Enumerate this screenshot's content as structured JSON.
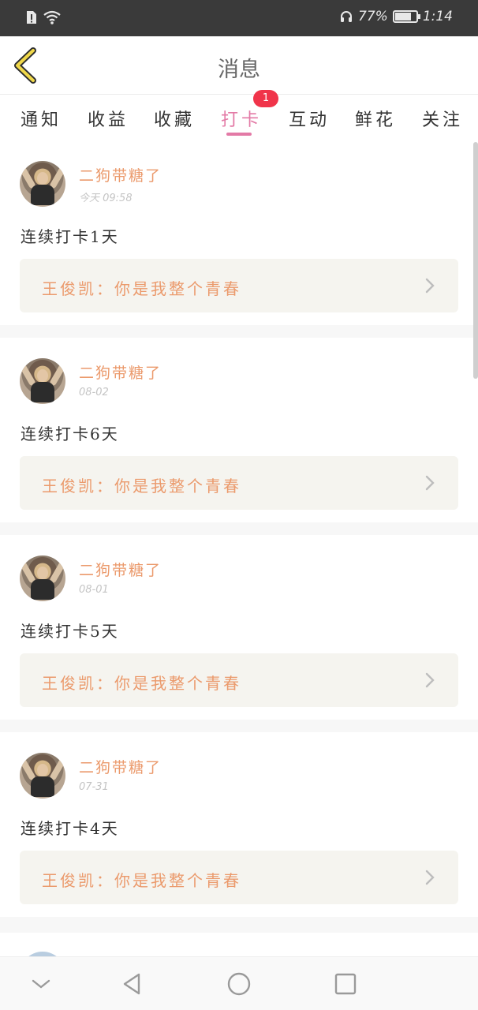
{
  "status_bar": {
    "battery_percent": "77%",
    "battery_level": 0.77,
    "time": "1:14",
    "icons": [
      "sim-alert-icon",
      "wifi-icon",
      "headphones-icon",
      "battery-icon"
    ]
  },
  "header": {
    "title": "消息",
    "back_icon": "chevron-left-icon"
  },
  "tabs": [
    {
      "label": "通知",
      "active": false
    },
    {
      "label": "收益",
      "active": false
    },
    {
      "label": "收藏",
      "active": false
    },
    {
      "label": "打卡",
      "active": true,
      "badge": "1"
    },
    {
      "label": "互动",
      "active": false
    },
    {
      "label": "鲜花",
      "active": false
    },
    {
      "label": "关注",
      "active": false
    }
  ],
  "colors": {
    "accent": "#e37aa6",
    "name": "#eb9a6c",
    "badge": "#f0344a"
  },
  "messages": [
    {
      "user": "二狗带糖了",
      "date": "今天 09:58",
      "text": "连续打卡1天",
      "quote": "王俊凯：你是我整个青春"
    },
    {
      "user": "二狗带糖了",
      "date": "08-02",
      "text": "连续打卡6天",
      "quote": "王俊凯：你是我整个青春"
    },
    {
      "user": "二狗带糖了",
      "date": "08-01",
      "text": "连续打卡5天",
      "quote": "王俊凯：你是我整个青春"
    },
    {
      "user": "二狗带糖了",
      "date": "07-31",
      "text": "连续打卡4天",
      "quote": "王俊凯：你是我整个青春"
    }
  ],
  "nav_bar": {
    "icons": [
      "collapse-icon",
      "back-triangle-icon",
      "home-circle-icon",
      "recent-square-icon"
    ]
  }
}
